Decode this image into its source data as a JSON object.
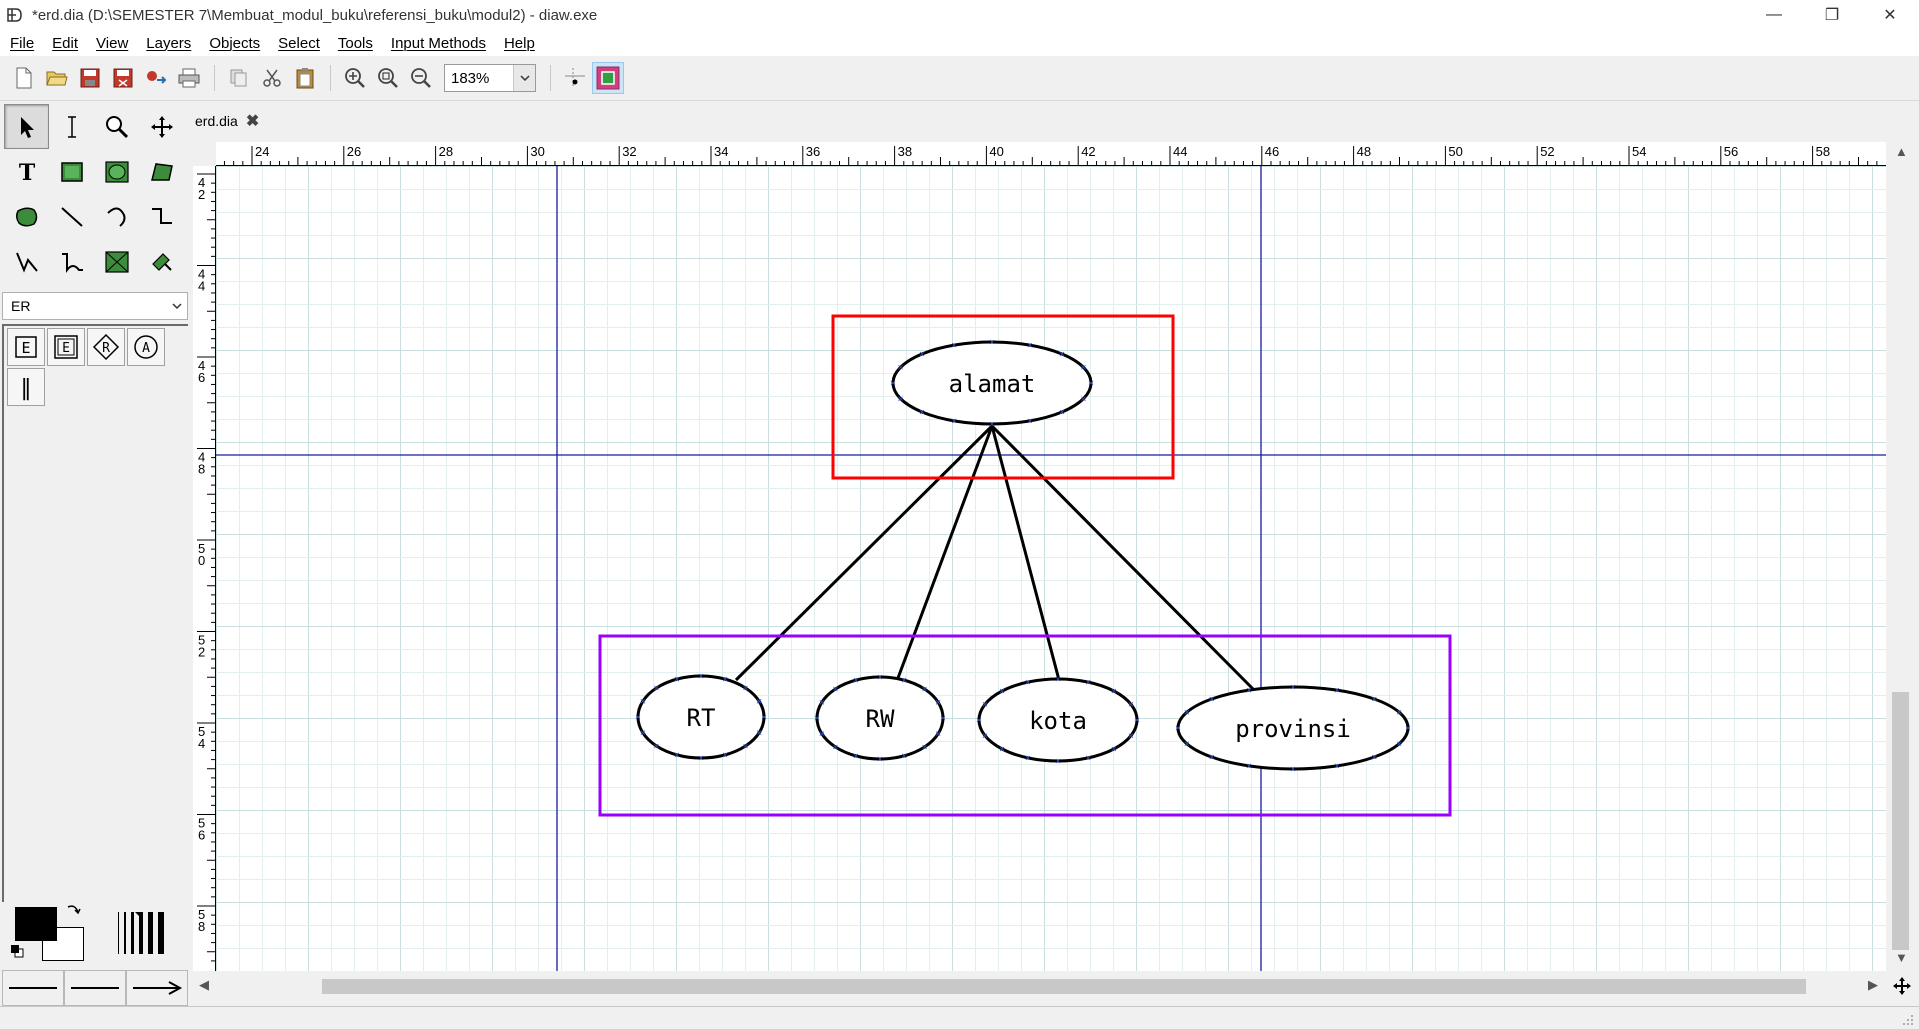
{
  "window": {
    "title": "*erd.dia (D:\\SEMESTER 7\\Membuat_modul_buku\\referensi_buku\\modul2) - diaw.exe",
    "minimize": "—",
    "maximize": "❐",
    "close": "✕"
  },
  "menu": [
    "File",
    "Edit",
    "View",
    "Layers",
    "Objects",
    "Select",
    "Tools",
    "Input Methods",
    "Help"
  ],
  "toolbar": {
    "zoom": "183%",
    "buttons": [
      "new-icon",
      "open-icon",
      "save-icon",
      "save-as-icon",
      "export-icon",
      "print-icon",
      "copy-icon",
      "cut-icon",
      "paste-icon",
      "zoom-in-icon",
      "zoom-fit-icon",
      "zoom-out-icon",
      "snap-to-grid-icon",
      "snap-to-objects-icon"
    ]
  },
  "toolbox": {
    "tools": [
      "pointer",
      "text-edit",
      "magnify",
      "scroll",
      "text",
      "box",
      "ellipse",
      "polygon",
      "beziergon",
      "line",
      "arc",
      "zigzag-line",
      "polyline",
      "bezier-line",
      "image",
      "outline"
    ],
    "sheet": "ER",
    "sheet_objects": [
      "E",
      "E",
      "R",
      "A",
      "‖"
    ],
    "foreground_color": "#000000",
    "background_color": "#ffffff"
  },
  "tab": {
    "label": "erd.dia",
    "close": "✖"
  },
  "rulers": {
    "horizontal_labels": [
      "24",
      "26",
      "28",
      "30",
      "32",
      "34",
      "36",
      "38",
      "40",
      "42",
      "44",
      "46",
      "48",
      "50",
      "52",
      "54",
      "56",
      "58"
    ],
    "vertical_labels": [
      "42",
      "44",
      "46",
      "48",
      "50",
      "52",
      "54",
      "56",
      "58"
    ]
  },
  "diagram": {
    "parent_attribute": "alamat",
    "child_attributes": [
      "RT",
      "RW",
      "kota",
      "provinsi"
    ],
    "parent_box_color": "#ff0000",
    "children_box_color": "#9900ff",
    "guide_color": "#00008b"
  }
}
